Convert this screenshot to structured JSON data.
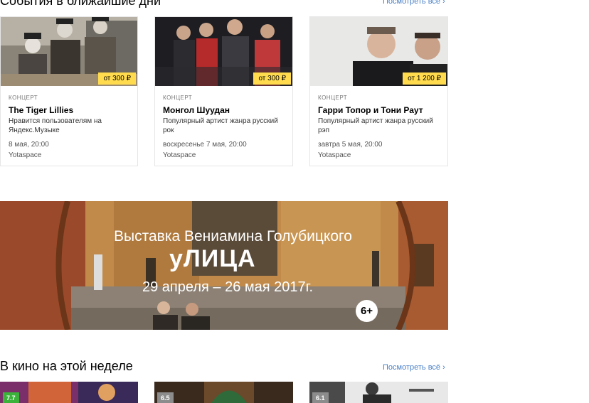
{
  "events": {
    "title": "События в ближайшие дни",
    "see_all": "Посмотреть всё ›",
    "cards": [
      {
        "category": "КОНЦЕРТ",
        "title": "The Tiger Lillies",
        "description": "Нравится пользователям на Яндекс.Музыке",
        "date": "8 мая, 20:00",
        "venue": "Yotaspace",
        "price": "от 300 ₽"
      },
      {
        "category": "КОНЦЕРТ",
        "title": "Монгол Шуудан",
        "description": "Популярный артист жанра русский рок",
        "date": "воскресенье 7 мая, 20:00",
        "venue": "Yotaspace",
        "price": "от 300 ₽"
      },
      {
        "category": "КОНЦЕРТ",
        "title": "Гарри Топор и Тони Раут",
        "description": "Популярный артист жанра русский рэп",
        "date": "завтра 5 мая, 20:00",
        "venue": "Yotaspace",
        "price": "от 1 200 ₽"
      }
    ]
  },
  "banner": {
    "subtitle": "Выставка Вениамина Голубицкого",
    "title": "уЛИЦА",
    "dates": "29 апреля – 26 мая 2017г.",
    "age": "6+"
  },
  "cinema": {
    "title": "В кино на этой неделе",
    "see_all": "Посмотреть всё ›",
    "films": [
      {
        "rating": "7.7",
        "rating_color": "#3bb33b"
      },
      {
        "rating": "6.5",
        "rating_color": "#8c8c8c"
      },
      {
        "rating": "6.1",
        "rating_color": "#8c8c8c"
      }
    ]
  }
}
